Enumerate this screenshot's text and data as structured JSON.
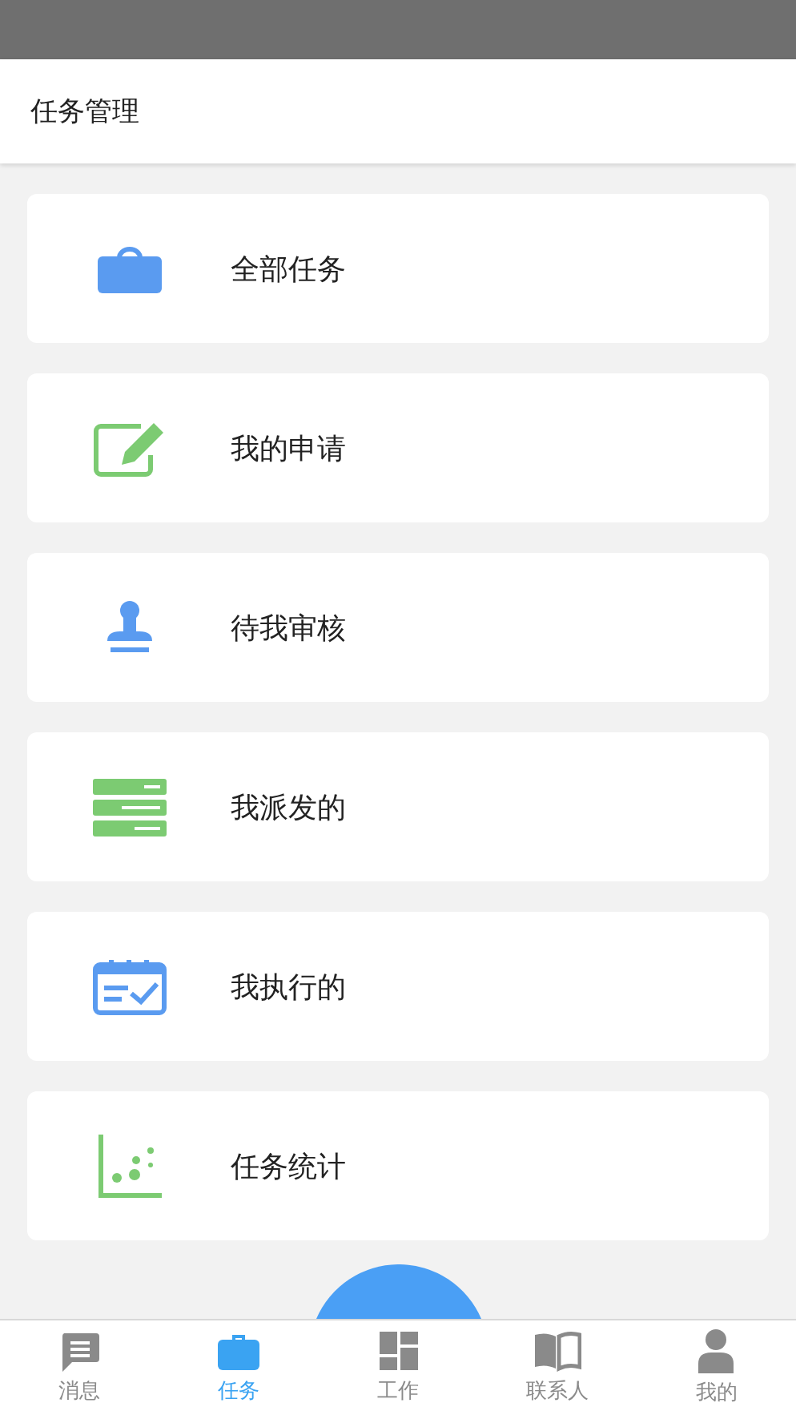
{
  "header": {
    "title": "任务管理"
  },
  "menu": [
    {
      "label": "全部任务",
      "kind": "bag",
      "color": "#5a9bf0"
    },
    {
      "label": "我的申请",
      "kind": "edit",
      "color": "#7ccb72"
    },
    {
      "label": "待我审核",
      "kind": "stamp",
      "color": "#5a9bf0"
    },
    {
      "label": "我派发的",
      "kind": "list",
      "color": "#7ccb72"
    },
    {
      "label": "我执行的",
      "kind": "calendar",
      "color": "#5a9bf0"
    },
    {
      "label": "任务统计",
      "kind": "scatter",
      "color": "#7ccb72"
    }
  ],
  "tabbar": [
    {
      "label": "消息",
      "kind": "message",
      "selected": false
    },
    {
      "label": "任务",
      "kind": "briefcase",
      "selected": true
    },
    {
      "label": "工作",
      "kind": "grid",
      "selected": false
    },
    {
      "label": "联系人",
      "kind": "book",
      "selected": false
    },
    {
      "label": "我的",
      "kind": "person",
      "selected": false
    }
  ]
}
